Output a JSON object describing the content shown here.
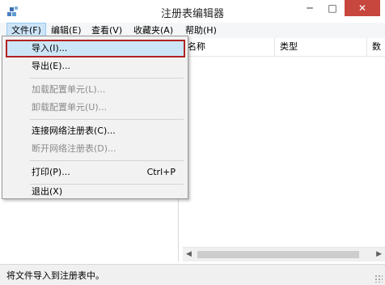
{
  "window": {
    "title": "注册表编辑器",
    "icon": "registry-editor-icon",
    "controls": {
      "minimize": "─",
      "maximize": "□",
      "close": "✕"
    }
  },
  "menubar": {
    "file": "文件(F)",
    "edit": "编辑(E)",
    "view": "查看(V)",
    "favorites": "收藏夹(A)",
    "help": "帮助(H)"
  },
  "file_menu": {
    "items": [
      {
        "label": "导入(I)...",
        "enabled": true,
        "highlighted": true
      },
      {
        "label": "导出(E)...",
        "enabled": true
      },
      {
        "label": "加载配置单元(L)...",
        "enabled": false
      },
      {
        "label": "卸载配置单元(U)...",
        "enabled": false
      },
      {
        "label": "连接网络注册表(C)...",
        "enabled": true
      },
      {
        "label": "断开网络注册表(D)...",
        "enabled": false
      },
      {
        "label": "打印(P)...",
        "enabled": true,
        "shortcut": "Ctrl+P"
      },
      {
        "label": "退出(X)",
        "enabled": true
      }
    ]
  },
  "list": {
    "columns": [
      "名称",
      "类型",
      "数"
    ]
  },
  "statusbar": {
    "text": "将文件导入到注册表中。"
  },
  "colors": {
    "highlight_border": "#b22222",
    "highlight_bg": "#cde6f7",
    "close_button": "#c7463d"
  }
}
